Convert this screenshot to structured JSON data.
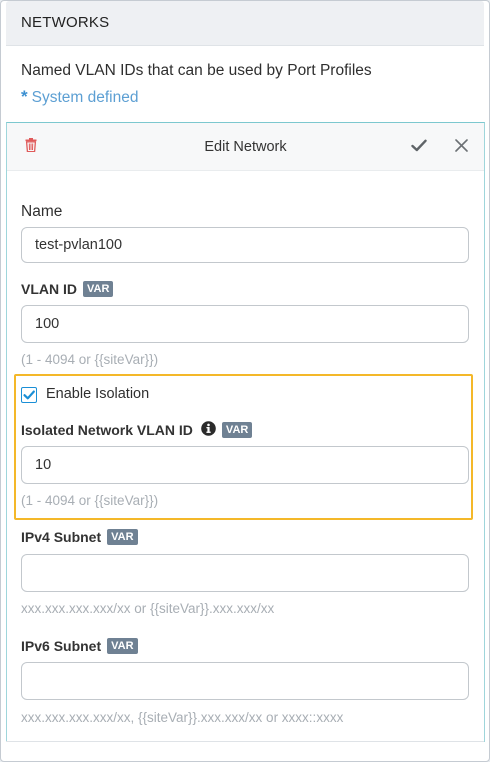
{
  "header": {
    "title": "NETWORKS"
  },
  "intro": {
    "description": "Named VLAN IDs that can be used by Port Profiles",
    "legend_star": "*",
    "legend_text": "System defined"
  },
  "editor": {
    "title": "Edit Network",
    "delete_icon": "trash-icon",
    "save_icon": "checkmark-icon",
    "close_icon": "close-icon",
    "name": {
      "label": "Name",
      "value": "test-pvlan100"
    },
    "vlan_id": {
      "label": "VLAN ID",
      "badge": "VAR",
      "value": "100",
      "hint": "(1 - 4094 or {{siteVar}})"
    },
    "isolation": {
      "label": "Enable Isolation",
      "checked": true
    },
    "isolated_vlan": {
      "label": "Isolated Network VLAN ID",
      "info_icon": "info-icon",
      "badge": "VAR",
      "value": "10",
      "hint": "(1 - 4094 or {{siteVar}})"
    },
    "ipv4": {
      "label": "IPv4 Subnet",
      "badge": "VAR",
      "value": "",
      "hint": "xxx.xxx.xxx.xxx/xx or {{siteVar}}.xxx.xxx/xx"
    },
    "ipv6": {
      "label": "IPv6 Subnet",
      "badge": "VAR",
      "value": "",
      "hint": "xxx.xxx.xxx.xxx/xx, {{siteVar}}.xxx.xxx/xx or xxxx::xxxx"
    }
  },
  "colors": {
    "accent": "#1a8fd6",
    "delete": "#e05a5a",
    "highlight": "#f4b829",
    "badge": "#6f8193",
    "legend": "#5c9fd3"
  }
}
